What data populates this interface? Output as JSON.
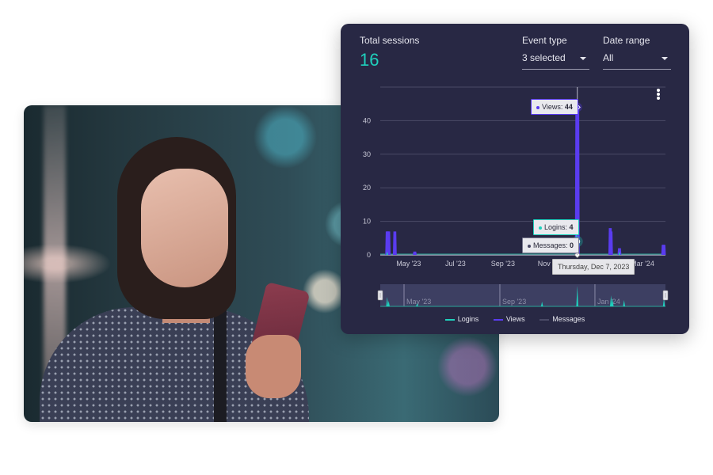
{
  "photo": {
    "alt": "Woman looking at her phone at night with city lights in background"
  },
  "dashboard": {
    "metric": {
      "label": "Total sessions",
      "value": "16"
    },
    "filters": [
      {
        "label": "Event type",
        "value": "3 selected"
      },
      {
        "label": "Date range",
        "value": "All"
      }
    ],
    "menu_icon": "kebab-menu-icon",
    "tooltips": {
      "views": {
        "series": "Views",
        "value": "44"
      },
      "logins": {
        "series": "Logins",
        "value": "4"
      },
      "messages": {
        "series": "Messages",
        "value": "0"
      },
      "date": "Thursday, Dec 7, 2023"
    },
    "legend": [
      {
        "label": "Logins",
        "color": "#1fd1bd"
      },
      {
        "label": "Views",
        "color": "#5a3cf0"
      },
      {
        "label": "Messages",
        "color": "#4a4a66"
      }
    ]
  },
  "chart_data": {
    "type": "area",
    "title": "",
    "xlabel": "",
    "ylabel": "",
    "ylim": [
      0,
      50
    ],
    "yticks": [
      0,
      10,
      20,
      30,
      40
    ],
    "xticks": [
      "May '23",
      "Jul '23",
      "Sep '23",
      "Nov '23",
      "Jan '24",
      "Mar '24"
    ],
    "grid": true,
    "legend_position": "bottom",
    "x_domain": [
      "2023-03-25",
      "2024-03-31"
    ],
    "series": [
      {
        "name": "Views",
        "color": "#5a3cf0",
        "points": [
          {
            "date": "2023-04-03",
            "value": 7
          },
          {
            "date": "2023-04-04",
            "value": 7
          },
          {
            "date": "2023-04-05",
            "value": 7
          },
          {
            "date": "2023-04-13",
            "value": 7
          },
          {
            "date": "2023-05-09",
            "value": 1
          },
          {
            "date": "2023-12-07",
            "value": 44
          },
          {
            "date": "2024-01-19",
            "value": 8
          },
          {
            "date": "2024-01-20",
            "value": 7
          },
          {
            "date": "2024-01-31",
            "value": 2
          },
          {
            "date": "2024-03-28",
            "value": 3
          },
          {
            "date": "2024-03-29",
            "value": 3
          }
        ]
      },
      {
        "name": "Logins",
        "color": "#1fd1bd",
        "points": [
          {
            "date": "2023-04-03",
            "value": 1
          },
          {
            "date": "2023-12-07",
            "value": 4
          },
          {
            "date": "2024-01-31",
            "value": 1
          }
        ]
      },
      {
        "name": "Messages",
        "color": "#4a4a66",
        "points": [
          {
            "date": "2023-12-07",
            "value": 0
          }
        ]
      }
    ],
    "navigator": {
      "labels": [
        "May '23",
        "Sep '23",
        "Jan '24"
      ]
    }
  }
}
